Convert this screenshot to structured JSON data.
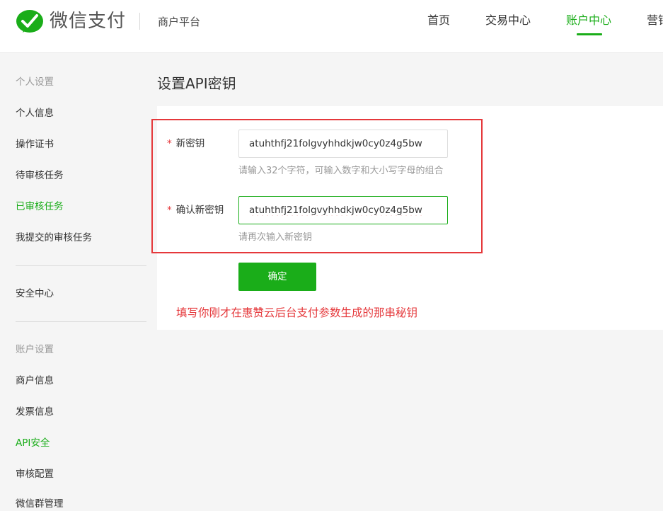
{
  "header": {
    "logo_text": "微信支付",
    "platform": "商户平台",
    "nav": [
      {
        "label": "首页"
      },
      {
        "label": "交易中心"
      },
      {
        "label": "账户中心",
        "active": true
      },
      {
        "label": "营销"
      }
    ]
  },
  "sidebar": {
    "sections": [
      "个人设置",
      "账户设置"
    ],
    "personal_items": [
      "个人信息",
      "操作证书",
      "待审核任务",
      "已审核任务",
      "我提交的审核任务"
    ],
    "security_center": "安全中心",
    "account_items": [
      "商户信息",
      "发票信息",
      "API安全",
      "审核配置",
      "微信群管理"
    ],
    "active_items": [
      "已审核任务",
      "API安全"
    ]
  },
  "main": {
    "title": "设置API密钥",
    "fields": [
      {
        "label": "新密钥",
        "required": "*",
        "value": "atuhthfj21folgvyhhdkjw0cy0z4g5bw",
        "hint": "请输入32个字符，可输入数字和大小写字母的组合"
      },
      {
        "label": "确认新密钥",
        "required": "*",
        "value": "atuhthfj21folgvyhhdkjw0cy0z4g5bw",
        "hint": "请再次输入新密钥"
      }
    ],
    "confirm_label": "确定",
    "annotation": "填写你刚才在惠赞云后台支付参数生成的那串秘钥"
  },
  "colors": {
    "accent": "#1aad19",
    "annotation": "#e5383b"
  },
  "icons": {
    "logo": "wechat-pay-logo-icon"
  }
}
